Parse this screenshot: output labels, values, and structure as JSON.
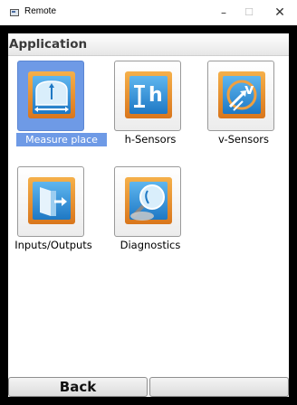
{
  "window": {
    "title": "Remote",
    "minimize_glyph": "–",
    "maximize_glyph": "☐",
    "close_glyph": "✕"
  },
  "header": {
    "title": "Application"
  },
  "tiles": [
    {
      "label": "Measure place",
      "icon": "measure-place-icon",
      "selected": true
    },
    {
      "label": "h-Sensors",
      "icon": "h-sensors-icon",
      "selected": false
    },
    {
      "label": "v-Sensors",
      "icon": "v-sensors-icon",
      "selected": false
    },
    {
      "label": "Inputs/Outputs",
      "icon": "inputs-outputs-icon",
      "selected": false
    },
    {
      "label": "Diagnostics",
      "icon": "diagnostics-icon",
      "selected": false
    }
  ],
  "footer": {
    "back_label": "Back",
    "right_label": ""
  },
  "colors": {
    "selection": "#6e9ae6",
    "icon_orange": "#e8902a",
    "icon_blue": "#2f8fd6",
    "bezel": "#000000"
  }
}
